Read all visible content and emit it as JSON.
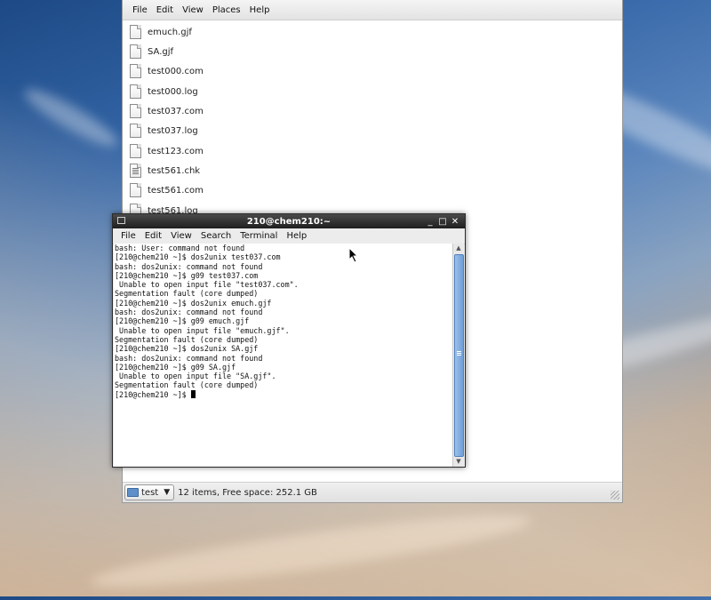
{
  "file_manager": {
    "menu": [
      "File",
      "Edit",
      "View",
      "Places",
      "Help"
    ],
    "files": [
      {
        "name": "emuch.gjf",
        "icon": "text-file-icon"
      },
      {
        "name": "SA.gjf",
        "icon": "text-file-icon"
      },
      {
        "name": "test000.com",
        "icon": "text-file-icon"
      },
      {
        "name": "test000.log",
        "icon": "text-file-icon"
      },
      {
        "name": "test037.com",
        "icon": "text-file-icon"
      },
      {
        "name": "test037.log",
        "icon": "text-file-icon"
      },
      {
        "name": "test123.com",
        "icon": "text-file-icon"
      },
      {
        "name": "test561.chk",
        "icon": "data-file-icon"
      },
      {
        "name": "test561.com",
        "icon": "text-file-icon"
      },
      {
        "name": "test561.log",
        "icon": "text-file-icon"
      }
    ],
    "location": "test",
    "status": "12 items, Free space: 252.1 GB"
  },
  "terminal": {
    "title": "210@chem210:~",
    "menu": [
      "File",
      "Edit",
      "View",
      "Search",
      "Terminal",
      "Help"
    ],
    "lines": [
      "bash: User: command not found",
      "[210@chem210 ~]$ dos2unix test037.com",
      "bash: dos2unix: command not found",
      "[210@chem210 ~]$ g09 test037.com",
      " Unable to open input file \"test037.com\".",
      "Segmentation fault (core dumped)",
      "[210@chem210 ~]$ dos2unix emuch.gjf",
      "bash: dos2unix: command not found",
      "[210@chem210 ~]$ g09 emuch.gjf",
      " Unable to open input file \"emuch.gjf\".",
      "Segmentation fault (core dumped)",
      "[210@chem210 ~]$ dos2unix SA.gjf",
      "bash: dos2unix: command not found",
      "[210@chem210 ~]$ g09 SA.gjf",
      " Unable to open input file \"SA.gjf\".",
      "Segmentation fault (core dumped)"
    ],
    "prompt": "[210@chem210 ~]$ ",
    "buttons": {
      "minimize": "_",
      "maximize": "□",
      "close": "✕"
    }
  }
}
